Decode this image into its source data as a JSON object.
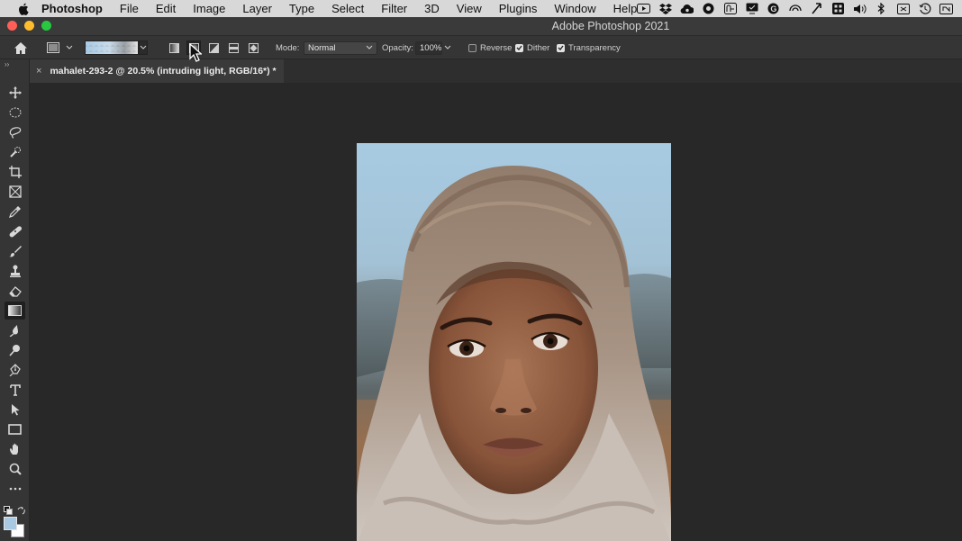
{
  "menubar": {
    "app_name": "Photoshop",
    "items": [
      "File",
      "Edit",
      "Image",
      "Layer",
      "Type",
      "Select",
      "Filter",
      "3D",
      "View",
      "Plugins",
      "Window",
      "Help"
    ],
    "status_icons": [
      "screen-record-icon",
      "dropbox-icon",
      "creative-cloud-icon",
      "chrome-icon",
      "app-icon",
      "display-icon",
      "grammarly-icon",
      "airplay-icon",
      "cloud-icon",
      "control-center-icon",
      "volume-icon",
      "bluetooth-icon",
      "screen-icon",
      "time-machine-icon",
      "wifi-icon"
    ]
  },
  "window": {
    "title": "Adobe Photoshop 2021"
  },
  "options_bar": {
    "mode_label": "Mode:",
    "mode_value": "Normal",
    "opacity_label": "Opacity:",
    "opacity_value": "100%",
    "reverse_label": "Reverse",
    "reverse_checked": false,
    "dither_label": "Dither",
    "dither_checked": true,
    "transparency_label": "Transparency",
    "transparency_checked": true,
    "gradient_types": [
      "linear-gradient-icon",
      "radial-gradient-icon",
      "angle-gradient-icon",
      "reflected-gradient-icon",
      "diamond-gradient-icon"
    ],
    "active_gradient_type": "radial-gradient-icon",
    "gradient_colors": [
      "#a9c9e3",
      "#e5e5e5"
    ]
  },
  "document": {
    "tab_title": "mahalet-293-2 @ 20.5% (intruding light, RGB/16*) *"
  },
  "tools": [
    "move-icon",
    "marquee-icon",
    "lasso-icon",
    "quick-selection-icon",
    "crop-icon",
    "frame-icon",
    "eyedropper-icon",
    "healing-brush-icon",
    "brush-icon",
    "clone-stamp-icon",
    "eraser-icon",
    "gradient-icon",
    "blur-icon",
    "dodge-icon",
    "pen-icon",
    "type-icon",
    "path-selection-icon",
    "rectangle-icon",
    "hand-icon",
    "zoom-icon",
    "more-tools-icon"
  ],
  "active_tool": "gradient-icon",
  "colors": {
    "foreground": "#a9c9e3",
    "background": "#ffffff"
  }
}
